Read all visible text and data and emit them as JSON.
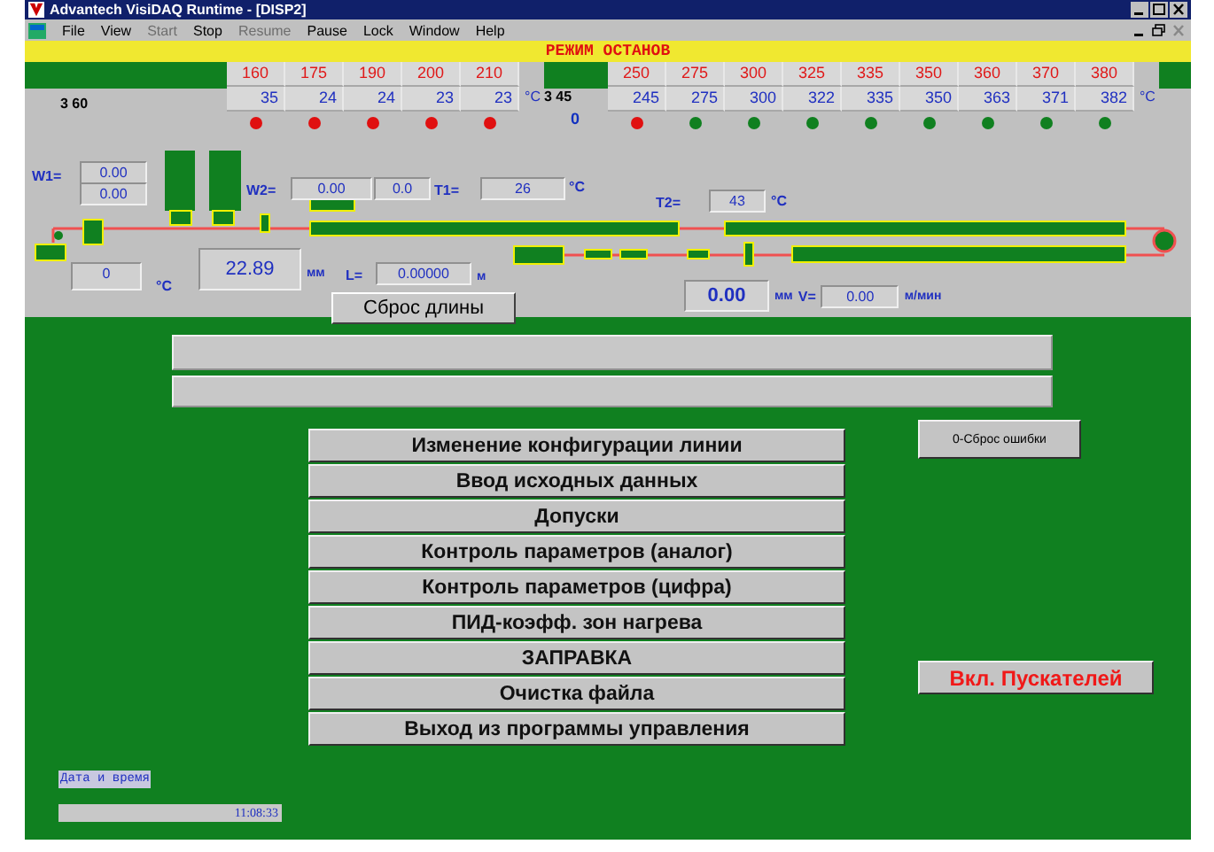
{
  "window": {
    "title": "Advantech VisiDAQ Runtime - [DISP2]"
  },
  "menu": [
    {
      "label": "File",
      "disabled": false
    },
    {
      "label": "View",
      "disabled": false
    },
    {
      "label": "Start",
      "disabled": true
    },
    {
      "label": "Stop",
      "disabled": false
    },
    {
      "label": "Resume",
      "disabled": true
    },
    {
      "label": "Pause",
      "disabled": false
    },
    {
      "label": "Lock",
      "disabled": false
    },
    {
      "label": "Window",
      "disabled": false
    },
    {
      "label": "Help",
      "disabled": false
    }
  ],
  "mode_banner": "РЕЖИМ ОСТАНОВ",
  "zone_groups": [
    {
      "label": "3 60",
      "unit": "°C",
      "zones": [
        {
          "setpoint": "160",
          "actual": "35",
          "alarm": true
        },
        {
          "setpoint": "175",
          "actual": "24",
          "alarm": true
        },
        {
          "setpoint": "190",
          "actual": "24",
          "alarm": true
        },
        {
          "setpoint": "200",
          "actual": "23",
          "alarm": true
        },
        {
          "setpoint": "210",
          "actual": "23",
          "alarm": true
        }
      ]
    },
    {
      "label": "3 45",
      "reading": "0",
      "unit": "°C",
      "zones": [
        {
          "setpoint": "250",
          "actual": "245",
          "alarm": true
        },
        {
          "setpoint": "275",
          "actual": "275",
          "alarm": false
        },
        {
          "setpoint": "300",
          "actual": "300",
          "alarm": false
        },
        {
          "setpoint": "325",
          "actual": "322",
          "alarm": false
        },
        {
          "setpoint": "335",
          "actual": "335",
          "alarm": false
        },
        {
          "setpoint": "350",
          "actual": "350",
          "alarm": false
        },
        {
          "setpoint": "360",
          "actual": "363",
          "alarm": false
        },
        {
          "setpoint": "370",
          "actual": "371",
          "alarm": false
        },
        {
          "setpoint": "380",
          "actual": "382",
          "alarm": false
        }
      ]
    }
  ],
  "w1": {
    "label": "W1=",
    "values": [
      "0.00",
      "0.00"
    ]
  },
  "w2": {
    "label": "W2=",
    "values": [
      "0.00",
      "0.0"
    ]
  },
  "t1": {
    "label": "T1=",
    "value": "26",
    "unit": "°C"
  },
  "t2": {
    "label": "T2=",
    "value": "43",
    "unit": "°C"
  },
  "temperature": {
    "value": "0",
    "unit": "°C"
  },
  "thickness": {
    "value": "22.89",
    "unit": "мм"
  },
  "length": {
    "label": "L=",
    "value": "0.00000",
    "unit": "м"
  },
  "reset_length_button": "Сброс длины",
  "diameter": {
    "value": "0.00",
    "unit": "мм"
  },
  "speed": {
    "label": "V=",
    "value": "0.00",
    "unit": "м/мин"
  },
  "menu_buttons": [
    "Изменение конфигурации линии",
    "Ввод исходных данных",
    "Допуски",
    "Контроль параметров (аналог)",
    "Контроль параметров (цифра)",
    "ПИД-коэфф. зон нагрева",
    "ЗАПРАВКА",
    "Очистка файла",
    "Выход из программы управления"
  ],
  "error_reset_button": "0-Сброс ошибки",
  "starters_button": "Вкл. Пускателей",
  "datetime": {
    "label": "Дата и время",
    "value": "11:08:33"
  }
}
